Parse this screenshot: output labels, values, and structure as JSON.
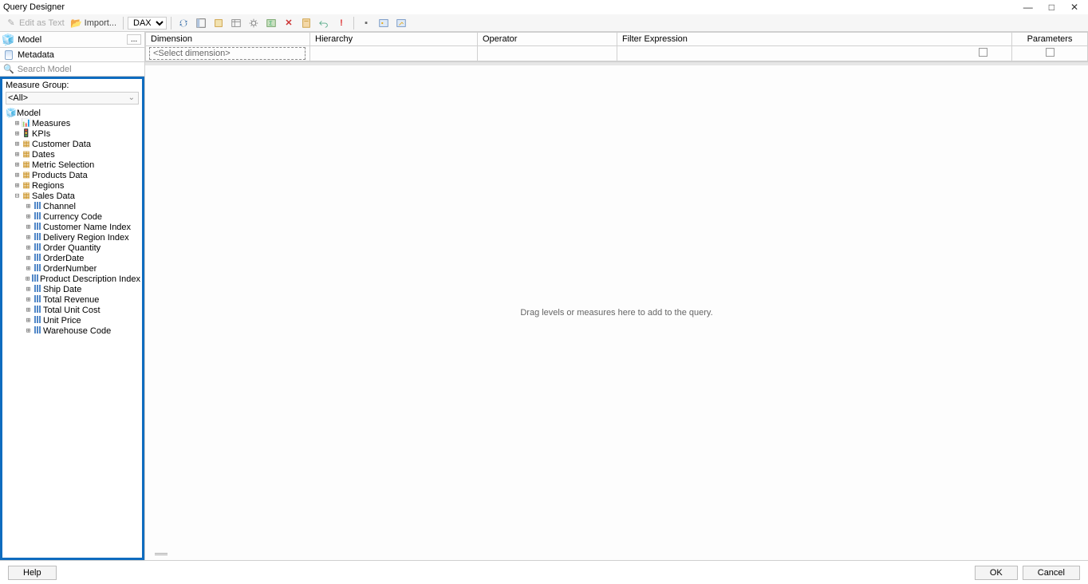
{
  "window": {
    "title": "Query Designer",
    "minimize": "—",
    "maximize": "□",
    "close": "✕"
  },
  "toolbar": {
    "edit_as_text": "Edit as Text",
    "import": "Import...",
    "lang_select": "DAX"
  },
  "left": {
    "model_label": "Model",
    "ellipsis": "...",
    "metadata_tab": "Metadata",
    "search_placeholder": "Search Model",
    "measure_group_label": "Measure Group:",
    "measure_group_value": "<All>"
  },
  "tree": {
    "root": "Model",
    "folders": [
      {
        "label": "Measures",
        "icon": "meas"
      },
      {
        "label": "KPIs",
        "icon": "kpi"
      },
      {
        "label": "Customer Data",
        "icon": "table"
      },
      {
        "label": "Dates",
        "icon": "table"
      },
      {
        "label": "Metric Selection",
        "icon": "table"
      },
      {
        "label": "Products Data",
        "icon": "table"
      },
      {
        "label": "Regions",
        "icon": "table"
      },
      {
        "label": "Sales Data",
        "icon": "table",
        "expanded": true
      }
    ],
    "sales_data_cols": [
      "Channel",
      "Currency Code",
      "Customer Name Index",
      "Delivery Region Index",
      "Order Quantity",
      "OrderDate",
      "OrderNumber",
      "Product Description Index",
      "Ship Date",
      "Total Revenue",
      "Total Unit Cost",
      "Unit Price",
      "Warehouse Code"
    ]
  },
  "grid": {
    "headers": {
      "dimension": "Dimension",
      "hierarchy": "Hierarchy",
      "operator": "Operator",
      "filter": "Filter Expression",
      "parameters": "Parameters"
    },
    "select_dimension": "<Select dimension>"
  },
  "query": {
    "drag_hint": "Drag levels or measures here to add to the query."
  },
  "footer": {
    "help": "Help",
    "ok": "OK",
    "cancel": "Cancel"
  }
}
